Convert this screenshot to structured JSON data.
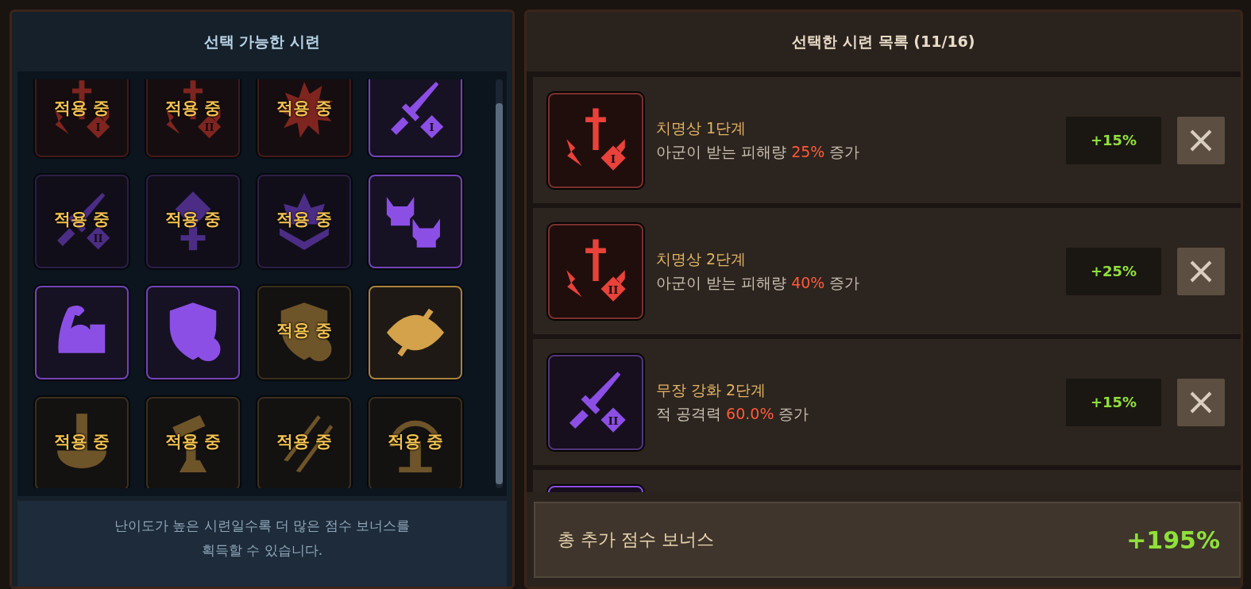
{
  "available_panel": {
    "title": "선택 가능한 시련",
    "tiles": [
      {
        "kind": "sword-bolt",
        "color": "#7e2520",
        "rank": "I",
        "applied": true,
        "badge": "적용 중"
      },
      {
        "kind": "sword-bolt",
        "color": "#7e2520",
        "rank": "II",
        "applied": true,
        "badge": "적용 중"
      },
      {
        "kind": "burst",
        "color": "#7e2520",
        "applied": true,
        "badge": "적용 중"
      },
      {
        "kind": "sword",
        "color": "#8c4fe6",
        "rank": "I",
        "applied": false
      },
      {
        "kind": "sword",
        "color": "#4c2d86",
        "rank": "II",
        "applied": true,
        "badge": "적용 중"
      },
      {
        "kind": "totem",
        "color": "#4c2d86",
        "applied": true,
        "badge": "적용 중"
      },
      {
        "kind": "crown",
        "color": "#4c2d86",
        "applied": true,
        "badge": "적용 중"
      },
      {
        "kind": "skulls",
        "color": "#8c4fe6",
        "applied": false
      },
      {
        "kind": "arm",
        "color": "#8c4fe6",
        "applied": false
      },
      {
        "kind": "shield",
        "color": "#8c4fe6",
        "applied": false
      },
      {
        "kind": "shield",
        "color": "#6e5429",
        "applied": true,
        "badge": "적용 중"
      },
      {
        "kind": "eye",
        "color": "#d4a24a",
        "applied": false
      },
      {
        "kind": "pillar",
        "color": "#6e5429",
        "applied": true,
        "badge": "적용 중"
      },
      {
        "kind": "hammer",
        "color": "#6e5429",
        "applied": true,
        "badge": "적용 중"
      },
      {
        "kind": "claws",
        "color": "#6e5429",
        "applied": true,
        "badge": "적용 중"
      },
      {
        "kind": "dome",
        "color": "#6e5429",
        "applied": true,
        "badge": "적용 중"
      }
    ],
    "note": "난이도가 높은 시련일수록 더 많은 점수 보너스를\n획득할 수 있습니다."
  },
  "selected_panel": {
    "title": "선택한 시련 목록 (11/16)",
    "items": [
      {
        "kind": "sword-bolt",
        "color": "#e8423a",
        "rank": "I",
        "name": "치명상 1단계",
        "description": "아군이 받는 피해량 **25%** 증가",
        "bonus": "+15%"
      },
      {
        "kind": "sword-bolt",
        "color": "#e8423a",
        "rank": "II",
        "name": "치명상 2단계",
        "description": "아군이 받는 피해량 **40%** 증가",
        "bonus": "+25%"
      },
      {
        "kind": "sword",
        "color": "#8c4fe6",
        "rank": "II",
        "name": "무장 강화 2단계",
        "description": "적 공격력 **60.0%** 증가",
        "bonus": "+15%"
      },
      {
        "kind": "blank",
        "color": "#8c4fe6"
      }
    ],
    "total_label": "총 추가 점수 보너스",
    "total_value": "+195%"
  }
}
